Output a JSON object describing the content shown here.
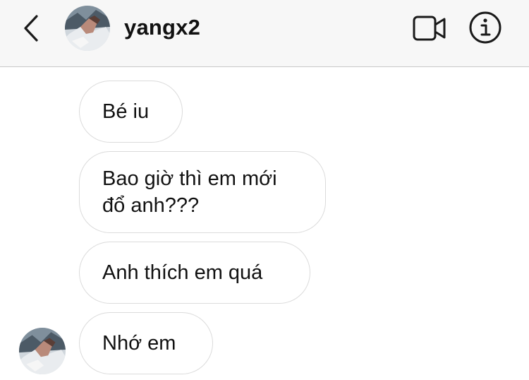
{
  "header": {
    "username": "yangx2",
    "icons": [
      "chevron-left-icon",
      "video-camera-icon",
      "info-icon"
    ]
  },
  "messages": [
    {
      "text": "Bé iu"
    },
    {
      "text": "Bao giờ thì em mới đổ anh???"
    },
    {
      "text": "Anh thích em quá"
    },
    {
      "text": "Nhớ em"
    }
  ],
  "colors": {
    "header_bg": "#f7f7f7",
    "bubble_border": "#dbdbdb",
    "text": "#111111",
    "divider": "#c9c9c9"
  }
}
